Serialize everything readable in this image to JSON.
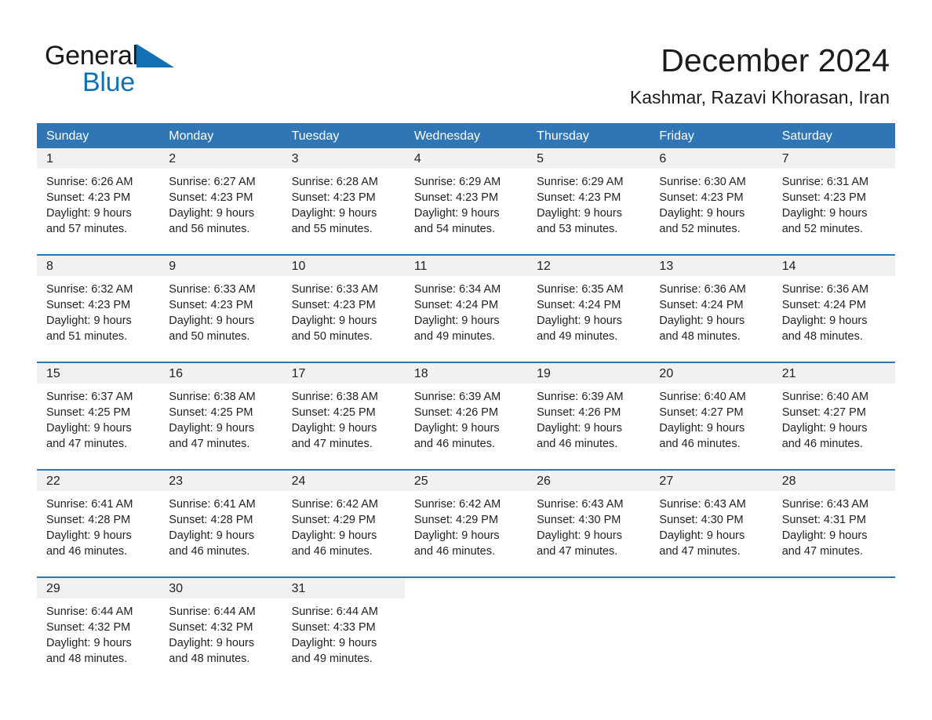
{
  "logo": {
    "part1": "General",
    "part2": "Blue",
    "triangle_color": "#1271b5",
    "text_color": "#1a1a1a"
  },
  "header": {
    "title": "December 2024",
    "subtitle": "Kashmar, Razavi Khorasan, Iran"
  },
  "theme": {
    "header_blue": "#3075b4",
    "daynum_band": "#f1f1f1",
    "text": "#222222",
    "background": "#ffffff"
  },
  "calendar": {
    "day_headers": [
      "Sunday",
      "Monday",
      "Tuesday",
      "Wednesday",
      "Thursday",
      "Friday",
      "Saturday"
    ],
    "weeks": [
      [
        {
          "day": "1",
          "sunrise": "Sunrise: 6:26 AM",
          "sunset": "Sunset: 4:23 PM",
          "daylight_line1": "Daylight: 9 hours",
          "daylight_line2": "and 57 minutes."
        },
        {
          "day": "2",
          "sunrise": "Sunrise: 6:27 AM",
          "sunset": "Sunset: 4:23 PM",
          "daylight_line1": "Daylight: 9 hours",
          "daylight_line2": "and 56 minutes."
        },
        {
          "day": "3",
          "sunrise": "Sunrise: 6:28 AM",
          "sunset": "Sunset: 4:23 PM",
          "daylight_line1": "Daylight: 9 hours",
          "daylight_line2": "and 55 minutes."
        },
        {
          "day": "4",
          "sunrise": "Sunrise: 6:29 AM",
          "sunset": "Sunset: 4:23 PM",
          "daylight_line1": "Daylight: 9 hours",
          "daylight_line2": "and 54 minutes."
        },
        {
          "day": "5",
          "sunrise": "Sunrise: 6:29 AM",
          "sunset": "Sunset: 4:23 PM",
          "daylight_line1": "Daylight: 9 hours",
          "daylight_line2": "and 53 minutes."
        },
        {
          "day": "6",
          "sunrise": "Sunrise: 6:30 AM",
          "sunset": "Sunset: 4:23 PM",
          "daylight_line1": "Daylight: 9 hours",
          "daylight_line2": "and 52 minutes."
        },
        {
          "day": "7",
          "sunrise": "Sunrise: 6:31 AM",
          "sunset": "Sunset: 4:23 PM",
          "daylight_line1": "Daylight: 9 hours",
          "daylight_line2": "and 52 minutes."
        }
      ],
      [
        {
          "day": "8",
          "sunrise": "Sunrise: 6:32 AM",
          "sunset": "Sunset: 4:23 PM",
          "daylight_line1": "Daylight: 9 hours",
          "daylight_line2": "and 51 minutes."
        },
        {
          "day": "9",
          "sunrise": "Sunrise: 6:33 AM",
          "sunset": "Sunset: 4:23 PM",
          "daylight_line1": "Daylight: 9 hours",
          "daylight_line2": "and 50 minutes."
        },
        {
          "day": "10",
          "sunrise": "Sunrise: 6:33 AM",
          "sunset": "Sunset: 4:23 PM",
          "daylight_line1": "Daylight: 9 hours",
          "daylight_line2": "and 50 minutes."
        },
        {
          "day": "11",
          "sunrise": "Sunrise: 6:34 AM",
          "sunset": "Sunset: 4:24 PM",
          "daylight_line1": "Daylight: 9 hours",
          "daylight_line2": "and 49 minutes."
        },
        {
          "day": "12",
          "sunrise": "Sunrise: 6:35 AM",
          "sunset": "Sunset: 4:24 PM",
          "daylight_line1": "Daylight: 9 hours",
          "daylight_line2": "and 49 minutes."
        },
        {
          "day": "13",
          "sunrise": "Sunrise: 6:36 AM",
          "sunset": "Sunset: 4:24 PM",
          "daylight_line1": "Daylight: 9 hours",
          "daylight_line2": "and 48 minutes."
        },
        {
          "day": "14",
          "sunrise": "Sunrise: 6:36 AM",
          "sunset": "Sunset: 4:24 PM",
          "daylight_line1": "Daylight: 9 hours",
          "daylight_line2": "and 48 minutes."
        }
      ],
      [
        {
          "day": "15",
          "sunrise": "Sunrise: 6:37 AM",
          "sunset": "Sunset: 4:25 PM",
          "daylight_line1": "Daylight: 9 hours",
          "daylight_line2": "and 47 minutes."
        },
        {
          "day": "16",
          "sunrise": "Sunrise: 6:38 AM",
          "sunset": "Sunset: 4:25 PM",
          "daylight_line1": "Daylight: 9 hours",
          "daylight_line2": "and 47 minutes."
        },
        {
          "day": "17",
          "sunrise": "Sunrise: 6:38 AM",
          "sunset": "Sunset: 4:25 PM",
          "daylight_line1": "Daylight: 9 hours",
          "daylight_line2": "and 47 minutes."
        },
        {
          "day": "18",
          "sunrise": "Sunrise: 6:39 AM",
          "sunset": "Sunset: 4:26 PM",
          "daylight_line1": "Daylight: 9 hours",
          "daylight_line2": "and 46 minutes."
        },
        {
          "day": "19",
          "sunrise": "Sunrise: 6:39 AM",
          "sunset": "Sunset: 4:26 PM",
          "daylight_line1": "Daylight: 9 hours",
          "daylight_line2": "and 46 minutes."
        },
        {
          "day": "20",
          "sunrise": "Sunrise: 6:40 AM",
          "sunset": "Sunset: 4:27 PM",
          "daylight_line1": "Daylight: 9 hours",
          "daylight_line2": "and 46 minutes."
        },
        {
          "day": "21",
          "sunrise": "Sunrise: 6:40 AM",
          "sunset": "Sunset: 4:27 PM",
          "daylight_line1": "Daylight: 9 hours",
          "daylight_line2": "and 46 minutes."
        }
      ],
      [
        {
          "day": "22",
          "sunrise": "Sunrise: 6:41 AM",
          "sunset": "Sunset: 4:28 PM",
          "daylight_line1": "Daylight: 9 hours",
          "daylight_line2": "and 46 minutes."
        },
        {
          "day": "23",
          "sunrise": "Sunrise: 6:41 AM",
          "sunset": "Sunset: 4:28 PM",
          "daylight_line1": "Daylight: 9 hours",
          "daylight_line2": "and 46 minutes."
        },
        {
          "day": "24",
          "sunrise": "Sunrise: 6:42 AM",
          "sunset": "Sunset: 4:29 PM",
          "daylight_line1": "Daylight: 9 hours",
          "daylight_line2": "and 46 minutes."
        },
        {
          "day": "25",
          "sunrise": "Sunrise: 6:42 AM",
          "sunset": "Sunset: 4:29 PM",
          "daylight_line1": "Daylight: 9 hours",
          "daylight_line2": "and 46 minutes."
        },
        {
          "day": "26",
          "sunrise": "Sunrise: 6:43 AM",
          "sunset": "Sunset: 4:30 PM",
          "daylight_line1": "Daylight: 9 hours",
          "daylight_line2": "and 47 minutes."
        },
        {
          "day": "27",
          "sunrise": "Sunrise: 6:43 AM",
          "sunset": "Sunset: 4:30 PM",
          "daylight_line1": "Daylight: 9 hours",
          "daylight_line2": "and 47 minutes."
        },
        {
          "day": "28",
          "sunrise": "Sunrise: 6:43 AM",
          "sunset": "Sunset: 4:31 PM",
          "daylight_line1": "Daylight: 9 hours",
          "daylight_line2": "and 47 minutes."
        }
      ],
      [
        {
          "day": "29",
          "sunrise": "Sunrise: 6:44 AM",
          "sunset": "Sunset: 4:32 PM",
          "daylight_line1": "Daylight: 9 hours",
          "daylight_line2": "and 48 minutes."
        },
        {
          "day": "30",
          "sunrise": "Sunrise: 6:44 AM",
          "sunset": "Sunset: 4:32 PM",
          "daylight_line1": "Daylight: 9 hours",
          "daylight_line2": "and 48 minutes."
        },
        {
          "day": "31",
          "sunrise": "Sunrise: 6:44 AM",
          "sunset": "Sunset: 4:33 PM",
          "daylight_line1": "Daylight: 9 hours",
          "daylight_line2": "and 49 minutes."
        },
        {
          "day": "",
          "sunrise": "",
          "sunset": "",
          "daylight_line1": "",
          "daylight_line2": ""
        },
        {
          "day": "",
          "sunrise": "",
          "sunset": "",
          "daylight_line1": "",
          "daylight_line2": ""
        },
        {
          "day": "",
          "sunrise": "",
          "sunset": "",
          "daylight_line1": "",
          "daylight_line2": ""
        },
        {
          "day": "",
          "sunrise": "",
          "sunset": "",
          "daylight_line1": "",
          "daylight_line2": ""
        }
      ]
    ]
  }
}
